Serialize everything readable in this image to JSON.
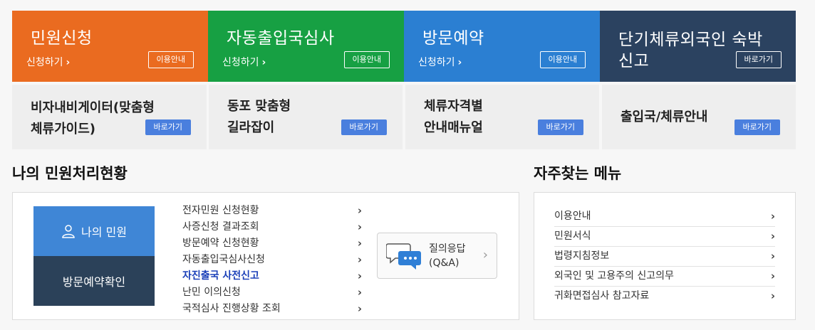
{
  "tiles": [
    {
      "title": "민원신청",
      "link": "신청하기",
      "button": "이용안내",
      "color": "#ea6b20"
    },
    {
      "title": "자동출입국심사",
      "link": "신청하기",
      "button": "이용안내",
      "color": "#17a043"
    },
    {
      "title": "방문예약",
      "link": "신청하기",
      "button": "이용안내",
      "color": "#2b7fd2"
    },
    {
      "title_line1": "단기체류외국인 숙박",
      "title_line2": "신고",
      "button": "바로가기",
      "color": "#2b4260"
    }
  ],
  "light_tiles": [
    {
      "line1": "비자내비게이터(맞춤형",
      "line2": "체류가이드)",
      "button": "바로가기"
    },
    {
      "line1": "동포 맞춤형",
      "line2": "길라잡이",
      "button": "바로가기"
    },
    {
      "line1": "체류자격별",
      "line2": "안내매뉴얼",
      "button": "바로가기"
    },
    {
      "line1": "출입국/체류안내",
      "button": "바로가기"
    }
  ],
  "my_status": {
    "title": "나의 민원처리현황",
    "my_civil_button": "나의 민원",
    "visit_check_button": "방문예약확인",
    "links": [
      "전자민원 신청현황",
      "사증신청 결과조회",
      "방문예약 신청현황",
      "자동출입국심사신청",
      "자진출국 사전신고",
      "난민 이의신청",
      "국적심사 진행상황 조회"
    ],
    "qa_line1": "질의응답",
    "qa_line2": "(Q&A)"
  },
  "faq_menu": {
    "title": "자주찾는 메뉴",
    "items": [
      "이용안내",
      "민원서식",
      "법령지침정보",
      "외국인 및 고용주의 신고의무",
      "귀화면접심사 참고자료"
    ]
  },
  "icons": {
    "chevron": "chevron-right-icon",
    "user": "user-icon",
    "chat": "chat-bubbles-icon"
  },
  "accent": {
    "link_highlight": "#1a3fb8",
    "blue_button": "#4a7fde",
    "user_box": "#3f86d6",
    "visit_box": "#2b4159"
  }
}
